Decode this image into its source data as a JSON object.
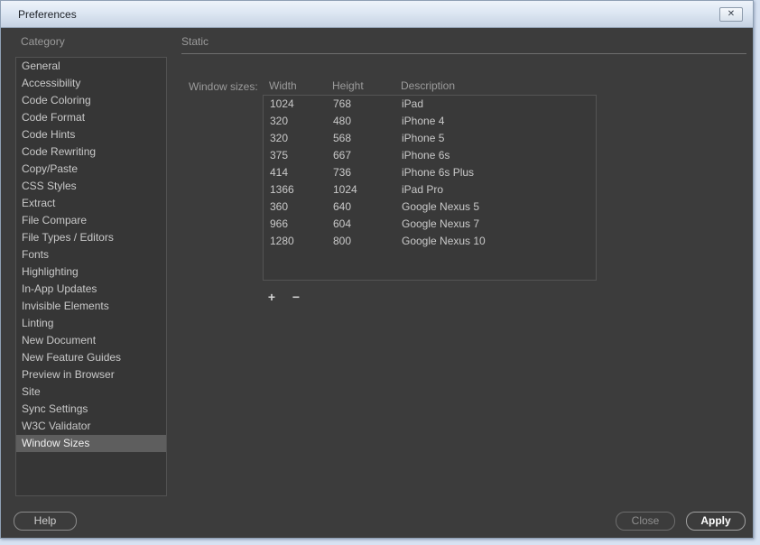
{
  "window": {
    "title": "Preferences",
    "close_glyph": "✕"
  },
  "sidebar": {
    "header": "Category",
    "items": [
      {
        "label": "General"
      },
      {
        "label": "Accessibility"
      },
      {
        "label": "Code Coloring"
      },
      {
        "label": "Code Format"
      },
      {
        "label": "Code Hints"
      },
      {
        "label": "Code Rewriting"
      },
      {
        "label": "Copy/Paste"
      },
      {
        "label": "CSS Styles"
      },
      {
        "label": "Extract"
      },
      {
        "label": "File Compare"
      },
      {
        "label": "File Types / Editors"
      },
      {
        "label": "Fonts"
      },
      {
        "label": "Highlighting"
      },
      {
        "label": "In-App Updates"
      },
      {
        "label": "Invisible Elements"
      },
      {
        "label": "Linting"
      },
      {
        "label": "New Document"
      },
      {
        "label": "New Feature Guides"
      },
      {
        "label": "Preview in Browser"
      },
      {
        "label": "Site"
      },
      {
        "label": "Sync Settings"
      },
      {
        "label": "W3C Validator"
      },
      {
        "label": "Window Sizes",
        "selected": true
      }
    ]
  },
  "main": {
    "section_title": "Static",
    "window_sizes_label": "Window sizes:",
    "columns": {
      "width": "Width",
      "height": "Height",
      "description": "Description"
    },
    "rows": [
      {
        "width": "1024",
        "height": "768",
        "description": "iPad"
      },
      {
        "width": "320",
        "height": "480",
        "description": "iPhone 4"
      },
      {
        "width": "320",
        "height": "568",
        "description": "iPhone 5"
      },
      {
        "width": "375",
        "height": "667",
        "description": "iPhone 6s"
      },
      {
        "width": "414",
        "height": "736",
        "description": "iPhone 6s Plus"
      },
      {
        "width": "1366",
        "height": "1024",
        "description": "iPad Pro"
      },
      {
        "width": "360",
        "height": "640",
        "description": "Google Nexus 5"
      },
      {
        "width": "966",
        "height": "604",
        "description": "Google Nexus 7"
      },
      {
        "width": "1280",
        "height": "800",
        "description": "Google Nexus 10"
      }
    ],
    "add_label": "+",
    "remove_label": "−"
  },
  "footer": {
    "help": "Help",
    "close": "Close",
    "apply": "Apply"
  },
  "colors": {
    "dialog_bg": "#3c3c3c",
    "listbox_bg": "#363636",
    "selection_bg": "#5e5e5e",
    "muted_text": "#9b9b9b",
    "item_text": "#c9c9c9",
    "titlebar_top": "#eef3fa",
    "titlebar_bottom": "#c6d2e2",
    "desktop_bg": "#d7e2f2"
  }
}
